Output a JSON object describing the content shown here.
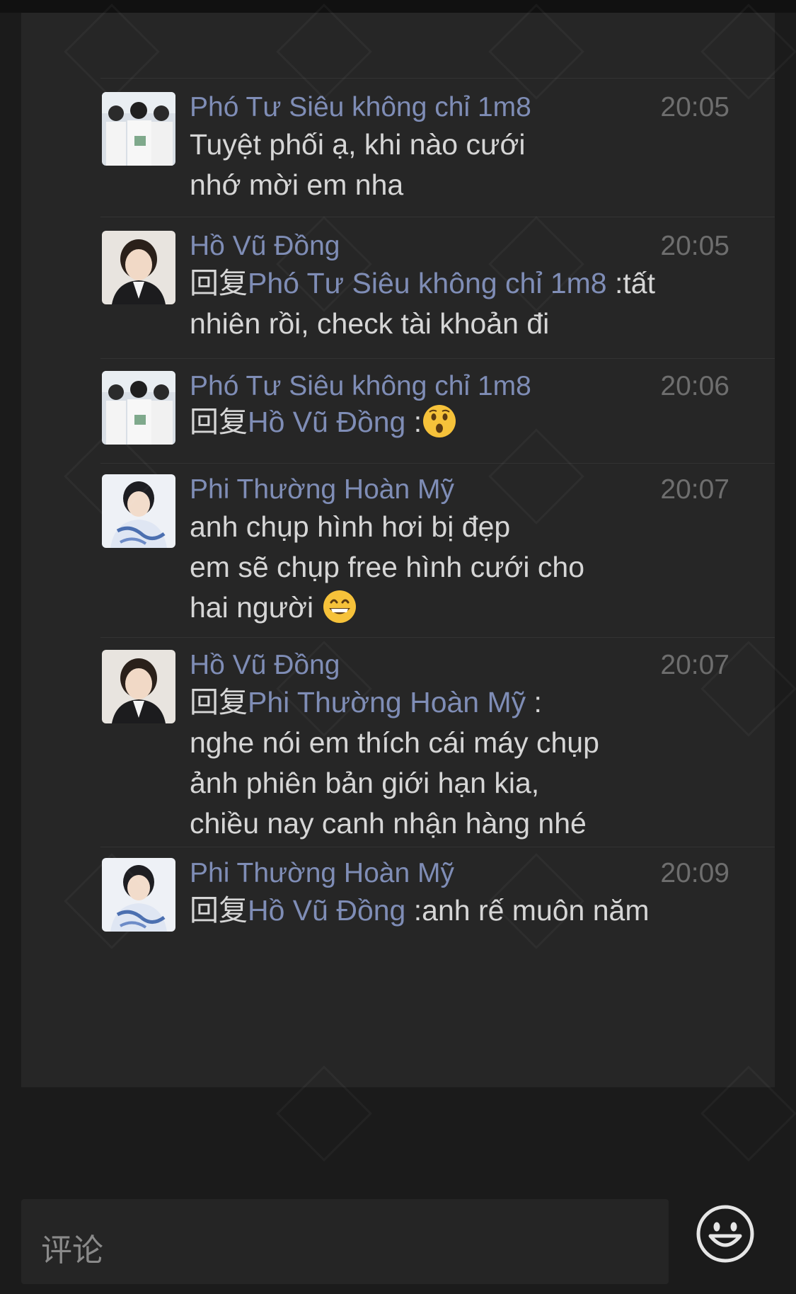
{
  "comments": [
    {
      "name": "Phó Tư Siêu không chỉ 1m8",
      "time": "20:05",
      "text": "Tuyệt phối ạ, khi nào cưới\nnhớ mời em nha",
      "avatar": "group-avatar"
    },
    {
      "name": "Hồ Vũ Đồng",
      "time": "20:05",
      "reply_prefix": "回复",
      "reply_target": "Phó Tư Siêu không chỉ 1m8",
      "text": " :tất\nnhiên rồi, check tài khoản đi",
      "avatar": "portrait-avatar"
    },
    {
      "name": "Phó Tư Siêu không chỉ 1m8",
      "time": "20:06",
      "reply_prefix": "回复",
      "reply_target": "Hồ Vũ Đồng",
      "text": " :",
      "emoji": "astonished-emoji",
      "avatar": "group-avatar"
    },
    {
      "name": "Phi Thường Hoàn Mỹ",
      "time": "20:07",
      "text": "anh chụp hình hơi bị đẹp\nem sẽ chụp free hình cưới cho\nhai người ",
      "emoji": "grin-emoji",
      "avatar": "boy-avatar"
    },
    {
      "name": "Hồ Vũ Đồng",
      "time": "20:07",
      "reply_prefix": "回复",
      "reply_target": "Phi Thường Hoàn Mỹ",
      "text": " :\nnghe nói em thích cái máy chụp\nảnh phiên bản giới hạn kia,\nchiều nay canh nhận hàng nhé",
      "avatar": "portrait-avatar"
    },
    {
      "name": "Phi Thường Hoàn Mỹ",
      "time": "20:09",
      "reply_prefix": "回复",
      "reply_target": "Hồ Vũ Đồng",
      "text": " :anh rế muôn năm",
      "avatar": "boy-avatar"
    }
  ],
  "input": {
    "placeholder": "评论",
    "emoji_button": "smiley-icon"
  },
  "colors": {
    "background": "#1b1b1b",
    "panel": "#262626",
    "name": "#7f8db6",
    "text": "#d6d6d6",
    "time": "#6e6e6e"
  }
}
